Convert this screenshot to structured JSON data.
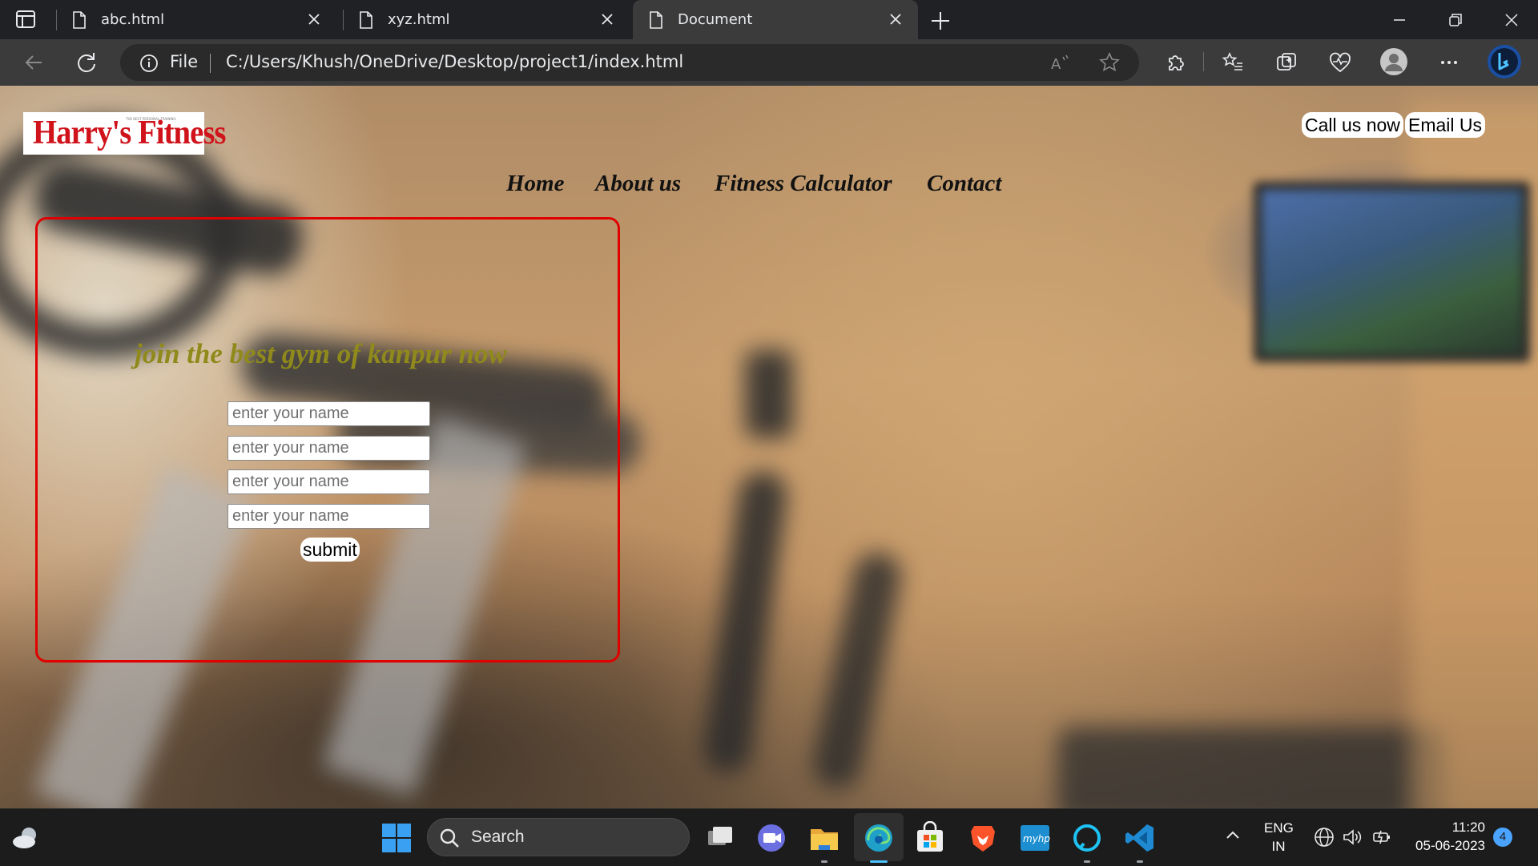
{
  "browser": {
    "tabs": [
      {
        "label": "abc.html",
        "active": false
      },
      {
        "label": "xyz.html",
        "active": false
      },
      {
        "label": "Document",
        "active": true
      }
    ],
    "address": {
      "scheme_label": "File",
      "url": "C:/Users/Khush/OneDrive/Desktop/project1/index.html"
    }
  },
  "page": {
    "logo": {
      "text": "Harry's Fitness",
      "tagline": "THE BEST PERSONAL TRAINING"
    },
    "top_links": [
      "Call us now",
      "Email Us"
    ],
    "nav": [
      "Home",
      "About us",
      "Fitness Calculator",
      "Contact"
    ],
    "form": {
      "heading": "join the best gym of kanpur now",
      "inputs": [
        {
          "placeholder": "enter your name"
        },
        {
          "placeholder": "enter your name"
        },
        {
          "placeholder": "enter your name"
        },
        {
          "placeholder": "enter your name"
        }
      ],
      "submit_label": "submit",
      "border_color": "#e00000",
      "heading_color": "#8f8a1b"
    }
  },
  "taskbar": {
    "search_label": "Search",
    "apps": [
      "task-view",
      "teams-chat",
      "file-explorer",
      "edge",
      "microsoft-store",
      "brave",
      "myhp",
      "alexa",
      "vscode"
    ],
    "tray": {
      "language": "ENG",
      "region": "IN",
      "time": "11:20",
      "date": "05-06-2023",
      "notifications": "4"
    }
  }
}
